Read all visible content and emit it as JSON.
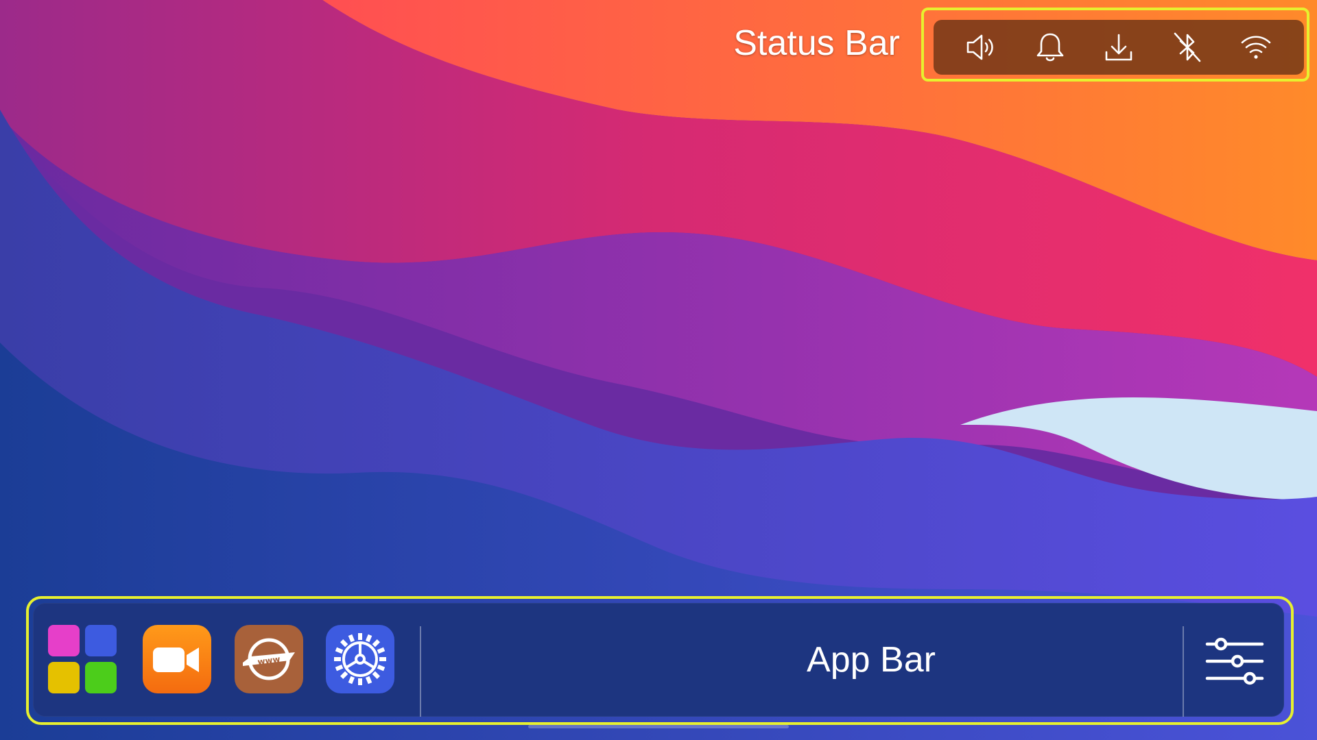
{
  "labels": {
    "status_bar": "Status Bar",
    "app_bar": "App Bar"
  },
  "status_bar": {
    "icons": [
      "speaker-icon",
      "bell-icon",
      "download-icon",
      "bluetooth-off-icon",
      "wifi-icon"
    ]
  },
  "app_bar": {
    "apps": [
      "app-launcher-icon",
      "video-camera-icon",
      "web-browser-icon",
      "settings-gear-icon"
    ],
    "right_control": "sliders-icon"
  },
  "colors": {
    "highlight_outline": "#e7f02f",
    "app_bar_bg": "#1d3580",
    "status_bar_bg": "#6e3416",
    "launcher_magenta": "#e63fc9",
    "launcher_blue": "#3d5be0",
    "launcher_yellow": "#e5c100",
    "launcher_green": "#4ccd1b",
    "video_orange": "#f67f14",
    "browser_brown": "#a8613a",
    "settings_blue": "#3d5be0"
  }
}
